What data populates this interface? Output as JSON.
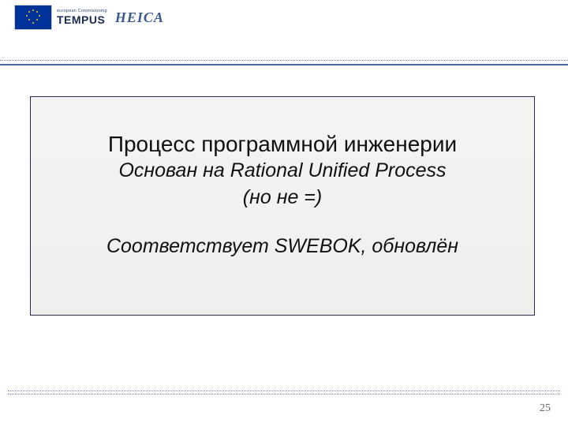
{
  "header": {
    "eu_flag_alt": "eu-flag",
    "tempus_small": "european Commisioning",
    "tempus_big": "TEMPUS",
    "heica": "HEICA"
  },
  "content": {
    "title": "Процесс программной инженерии",
    "sub1": "Основан на Rational Unified Process",
    "sub2": "(но не =)",
    "sub3": "Соответствует SWEBOK, обновлён"
  },
  "page": {
    "number": "25"
  }
}
